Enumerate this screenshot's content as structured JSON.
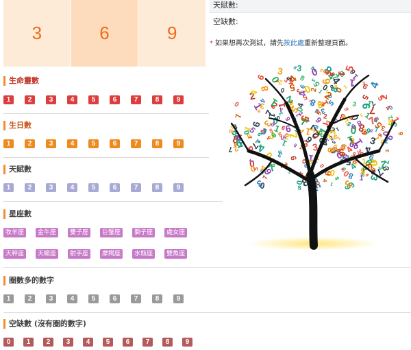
{
  "grid": [
    "3",
    "6",
    "9"
  ],
  "info": {
    "talent_label": "天賦數:",
    "missing_label": "空缺數:",
    "note_prefix": "如果想再次測試，請先",
    "note_link": "按此處",
    "note_suffix": "重新整理頁面。"
  },
  "sections": {
    "life": {
      "title": "生命靈數",
      "numbers": [
        "1",
        "2",
        "3",
        "4",
        "5",
        "6",
        "7",
        "8",
        "9"
      ]
    },
    "birthday": {
      "title": "生日數",
      "numbers": [
        "1",
        "2",
        "3",
        "4",
        "5",
        "6",
        "7",
        "8",
        "9"
      ]
    },
    "talent": {
      "title": "天賦數",
      "numbers": [
        "1",
        "2",
        "3",
        "4",
        "5",
        "6",
        "7",
        "8",
        "9"
      ]
    },
    "zodiac": {
      "title": "星座數",
      "row1": [
        "牧羊座",
        "金牛座",
        "雙子座",
        "巨蟹座",
        "獅子座",
        "處女座"
      ],
      "row2": [
        "天秤座",
        "天蠍座",
        "射手座",
        "摩羯座",
        "水瓶座",
        "雙魚座"
      ]
    },
    "most": {
      "title": "圈數多的數字",
      "numbers": [
        "1",
        "2",
        "3",
        "4",
        "5",
        "6",
        "7",
        "8",
        "9"
      ]
    },
    "missing": {
      "title": "空缺數 (沒有圈的數字)",
      "numbers": [
        "0",
        "1",
        "2",
        "3",
        "4",
        "5",
        "6",
        "7",
        "8",
        "9"
      ]
    }
  },
  "colors": {
    "life": "#dd3d3d",
    "birthday": "#ee8a1f",
    "talent": "#a9a9d6",
    "zodiac": "#c879c8",
    "most": "#9a9a9a",
    "missing": "#b55a5a",
    "grid_text": "#f26a18"
  },
  "icons": {
    "tree": "number-tree-icon"
  }
}
